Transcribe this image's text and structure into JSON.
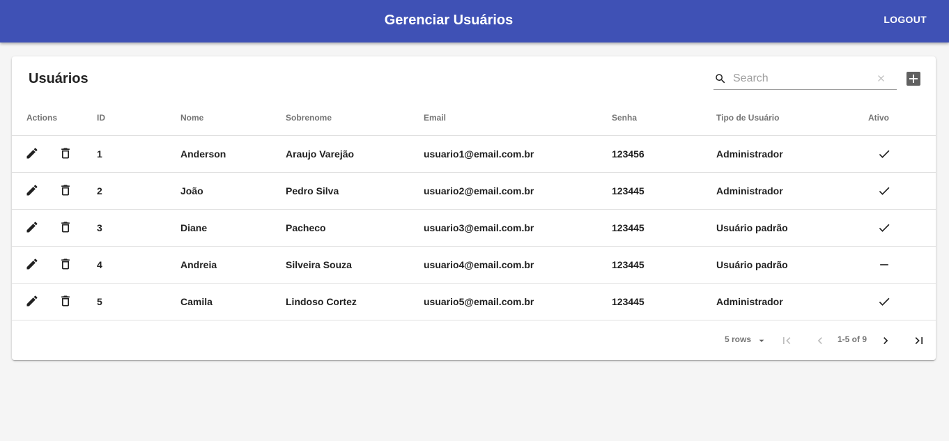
{
  "appbar": {
    "title": "Gerenciar Usuários",
    "logout_label": "LOGOUT"
  },
  "card": {
    "title": "Usuários",
    "search": {
      "placeholder": "Search",
      "value": ""
    }
  },
  "table": {
    "columns": [
      "Actions",
      "ID",
      "Nome",
      "Sobrenome",
      "Email",
      "Senha",
      "Tipo de Usuário",
      "Ativo"
    ],
    "rows": [
      {
        "id": "1",
        "nome": "Anderson",
        "sobrenome": "Araujo Varejão",
        "email": "usuario1@email.com.br",
        "senha": "123456",
        "tipo": "Administrador",
        "ativo": true
      },
      {
        "id": "2",
        "nome": "João",
        "sobrenome": "Pedro Silva",
        "email": "usuario2@email.com.br",
        "senha": "123445",
        "tipo": "Administrador",
        "ativo": true
      },
      {
        "id": "3",
        "nome": "Diane",
        "sobrenome": "Pacheco",
        "email": "usuario3@email.com.br",
        "senha": "123445",
        "tipo": "Usuário padrão",
        "ativo": true
      },
      {
        "id": "4",
        "nome": "Andreia",
        "sobrenome": "Silveira Souza",
        "email": "usuario4@email.com.br",
        "senha": "123445",
        "tipo": "Usuário padrão",
        "ativo": false
      },
      {
        "id": "5",
        "nome": "Camila",
        "sobrenome": "Lindoso Cortez",
        "email": "usuario5@email.com.br",
        "senha": "123445",
        "tipo": "Administrador",
        "ativo": true
      }
    ]
  },
  "pagination": {
    "rows_per_page": "5 rows",
    "range": "1-5 of 9"
  },
  "colors": {
    "primary": "#3f51b5",
    "background": "#f5f5f5",
    "icon": "#212121",
    "muted": "#757575"
  },
  "icons": [
    "search-icon",
    "clear-icon",
    "add-box-icon",
    "edit-icon",
    "delete-icon",
    "check-icon",
    "remove-icon",
    "arrow-drop-down-icon",
    "first-page-icon",
    "chevron-left-icon",
    "chevron-right-icon",
    "last-page-icon"
  ]
}
